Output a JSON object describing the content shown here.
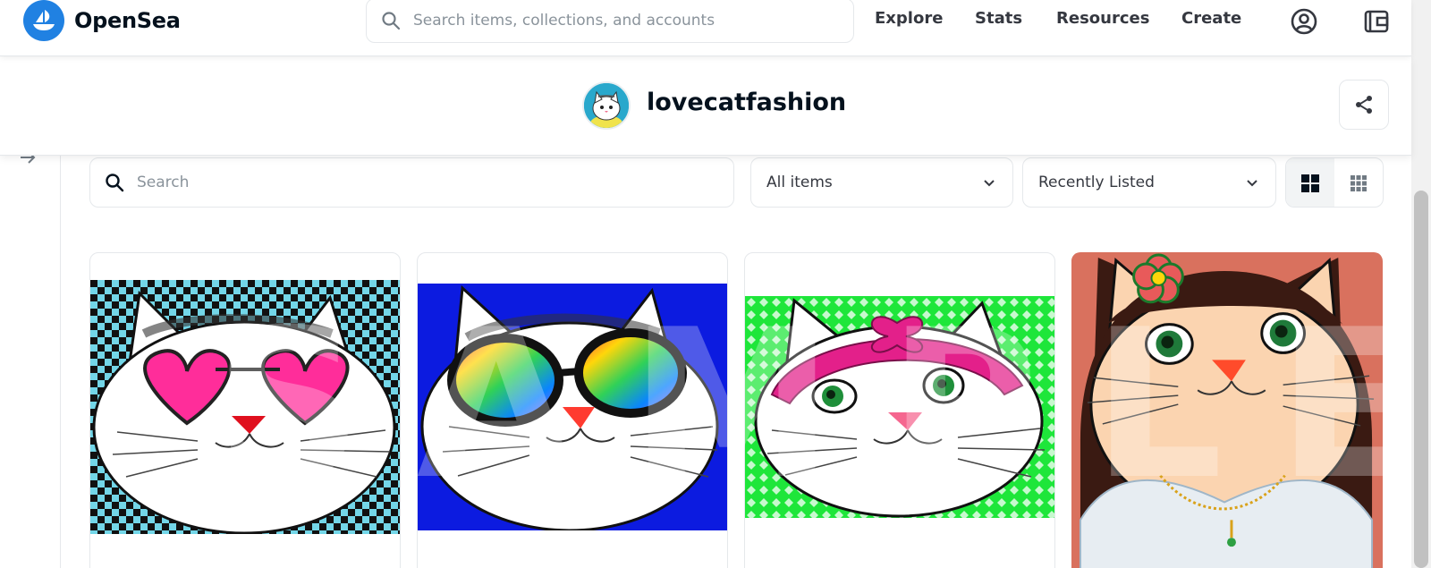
{
  "app": {
    "brand": "OpenSea",
    "search_placeholder": "Search items, collections, and accounts",
    "nav": [
      "Explore",
      "Stats",
      "Resources",
      "Create"
    ],
    "icons": [
      "account-icon",
      "wallet-icon"
    ]
  },
  "collection": {
    "name": "lovecatfashion",
    "share_icon": "share-icon"
  },
  "filters": {
    "search_placeholder": "Search",
    "item_filter": "All items",
    "sort": "Recently Listed",
    "view_modes": [
      "large-grid",
      "small-grid"
    ],
    "active_view": "large-grid"
  },
  "colors": {
    "brand_blue": "#2081e2",
    "text": "#04111d",
    "border": "#e5e8eb"
  },
  "items": [
    {
      "background": "#73d6e8",
      "pattern": "checker",
      "accessory": "heart-glasses",
      "accent": "#ff2d9a"
    },
    {
      "background": "#0c1be0",
      "pattern": "solid",
      "accessory": "rainbow-glasses",
      "accent": "#ff4040"
    },
    {
      "background": "#1ee63a",
      "pattern": "diamond",
      "accessory": "pink-bow",
      "accent": "#e3208a"
    },
    {
      "background": "#d9715e",
      "pattern": "solid",
      "accessory": "flower-hairband",
      "accent": "#f7cfa8"
    }
  ]
}
